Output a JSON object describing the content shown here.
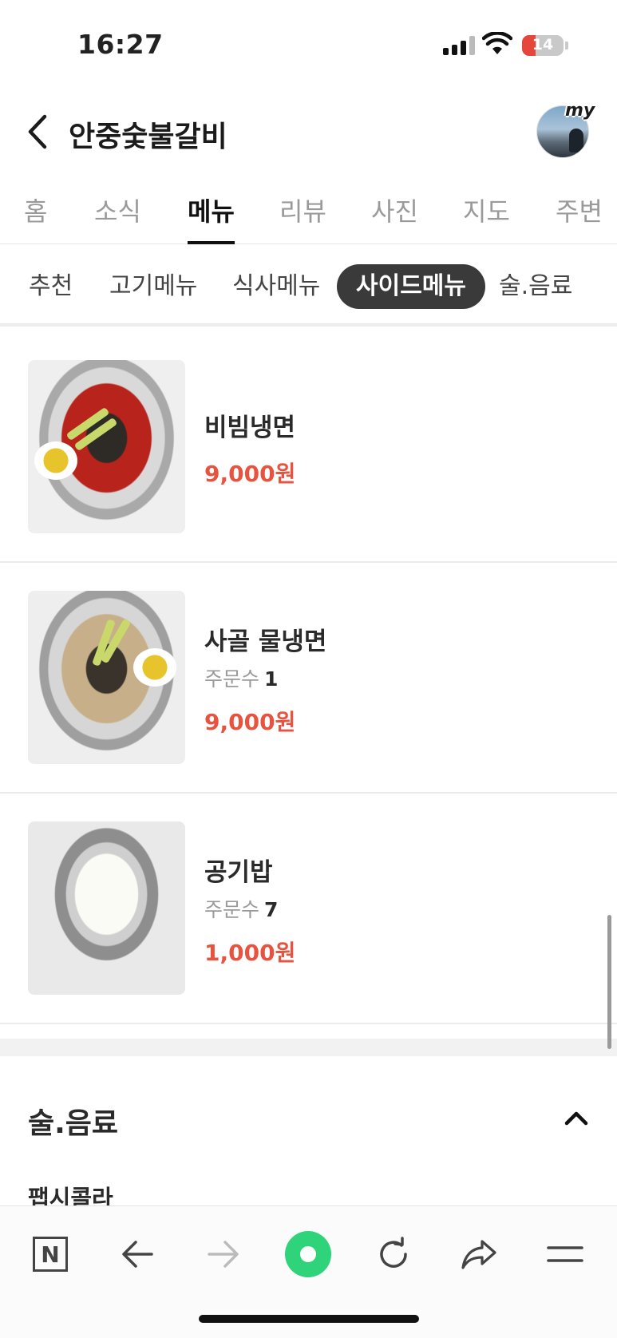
{
  "status_bar": {
    "time": "16:27",
    "battery": "14",
    "battery_level": 0.14
  },
  "header": {
    "title": "안중숯불갈비",
    "profile_badge": "my"
  },
  "main_tabs": [
    {
      "label": "홈"
    },
    {
      "label": "소식"
    },
    {
      "label": "메뉴",
      "active": true
    },
    {
      "label": "리뷰"
    },
    {
      "label": "사진"
    },
    {
      "label": "지도"
    },
    {
      "label": "주변"
    }
  ],
  "sub_tabs": [
    {
      "label": "추천"
    },
    {
      "label": "고기메뉴"
    },
    {
      "label": "식사메뉴"
    },
    {
      "label": "사이드메뉴",
      "active": true
    },
    {
      "label": "술.음료"
    }
  ],
  "menu_items": [
    {
      "name": "비빔냉면",
      "orders_label": "",
      "orders_count": "",
      "price": "9,000원",
      "image": "bibim-naengmyeon-photo"
    },
    {
      "name": "사골 물냉면",
      "orders_label": "주문수",
      "orders_count": "1",
      "price": "9,000원",
      "image": "mul-naengmyeon-photo"
    },
    {
      "name": "공기밥",
      "orders_label": "주문수",
      "orders_count": "7",
      "price": "1,000원",
      "image": "rice-bowl-photo"
    }
  ],
  "next_section": {
    "title": "술.음료",
    "first_item": "팹시콜라"
  },
  "toolbar": {
    "icons": [
      "naver-n-icon",
      "back-arrow-icon",
      "forward-arrow-icon",
      "green-dot-icon",
      "refresh-icon",
      "share-icon",
      "menu-icon"
    ],
    "n_label": "N"
  },
  "colors": {
    "price": "#e8533f",
    "active_pill": "#3a3a3a",
    "green": "#2fd47a",
    "battery_low": "#e5453b"
  }
}
